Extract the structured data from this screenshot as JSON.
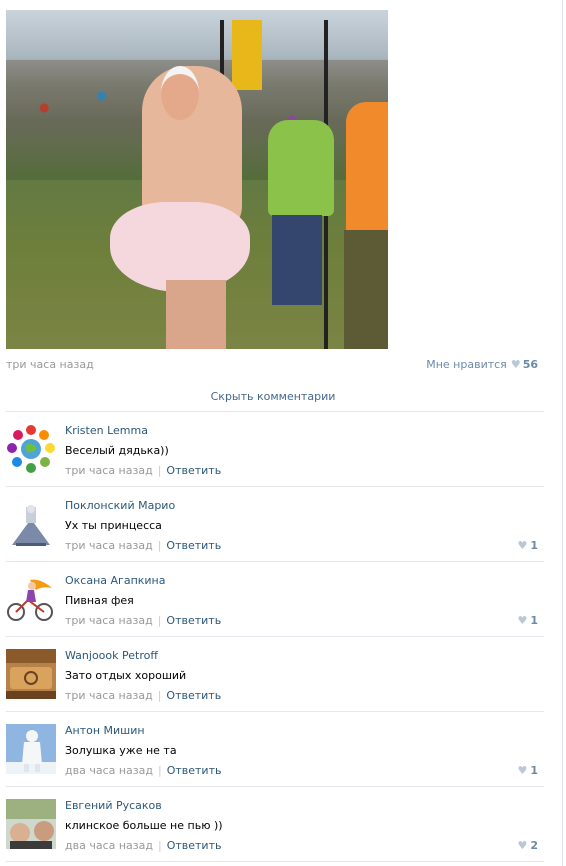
{
  "post": {
    "time": "три часа назад",
    "like_label": "Мне нравится",
    "like_count": "56"
  },
  "hide_comments_label": "Скрыть комментарии",
  "comments": [
    {
      "author": "Kristen Lemma",
      "text": "Веселый дядька))",
      "time": "три часа назад",
      "reply": "Ответить",
      "likes": ""
    },
    {
      "author": "Поклонский Марио",
      "text": "Ух ты принцесса",
      "time": "три часа назад",
      "reply": "Ответить",
      "likes": "1"
    },
    {
      "author": "Оксана Агапкина",
      "text": "Пивная фея",
      "time": "три часа назад",
      "reply": "Ответить",
      "likes": "1"
    },
    {
      "author": "Wanjoook Petroff",
      "text": "Зато отдых хороший",
      "time": "три часа назад",
      "reply": "Ответить",
      "likes": ""
    },
    {
      "author": "Антон Мишин",
      "text": "Золушка уже не та",
      "time": "два часа назад",
      "reply": "Ответить",
      "likes": "1"
    },
    {
      "author": "Евгений Русаков",
      "text": "клинское больше не пью ))",
      "time": "два часа назад",
      "reply": "Ответить",
      "likes": "2"
    }
  ],
  "icons": {
    "like": "heart-icon"
  },
  "colors": {
    "link": "#2b587a",
    "muted": "#999999",
    "like": "#6b8aa8"
  }
}
